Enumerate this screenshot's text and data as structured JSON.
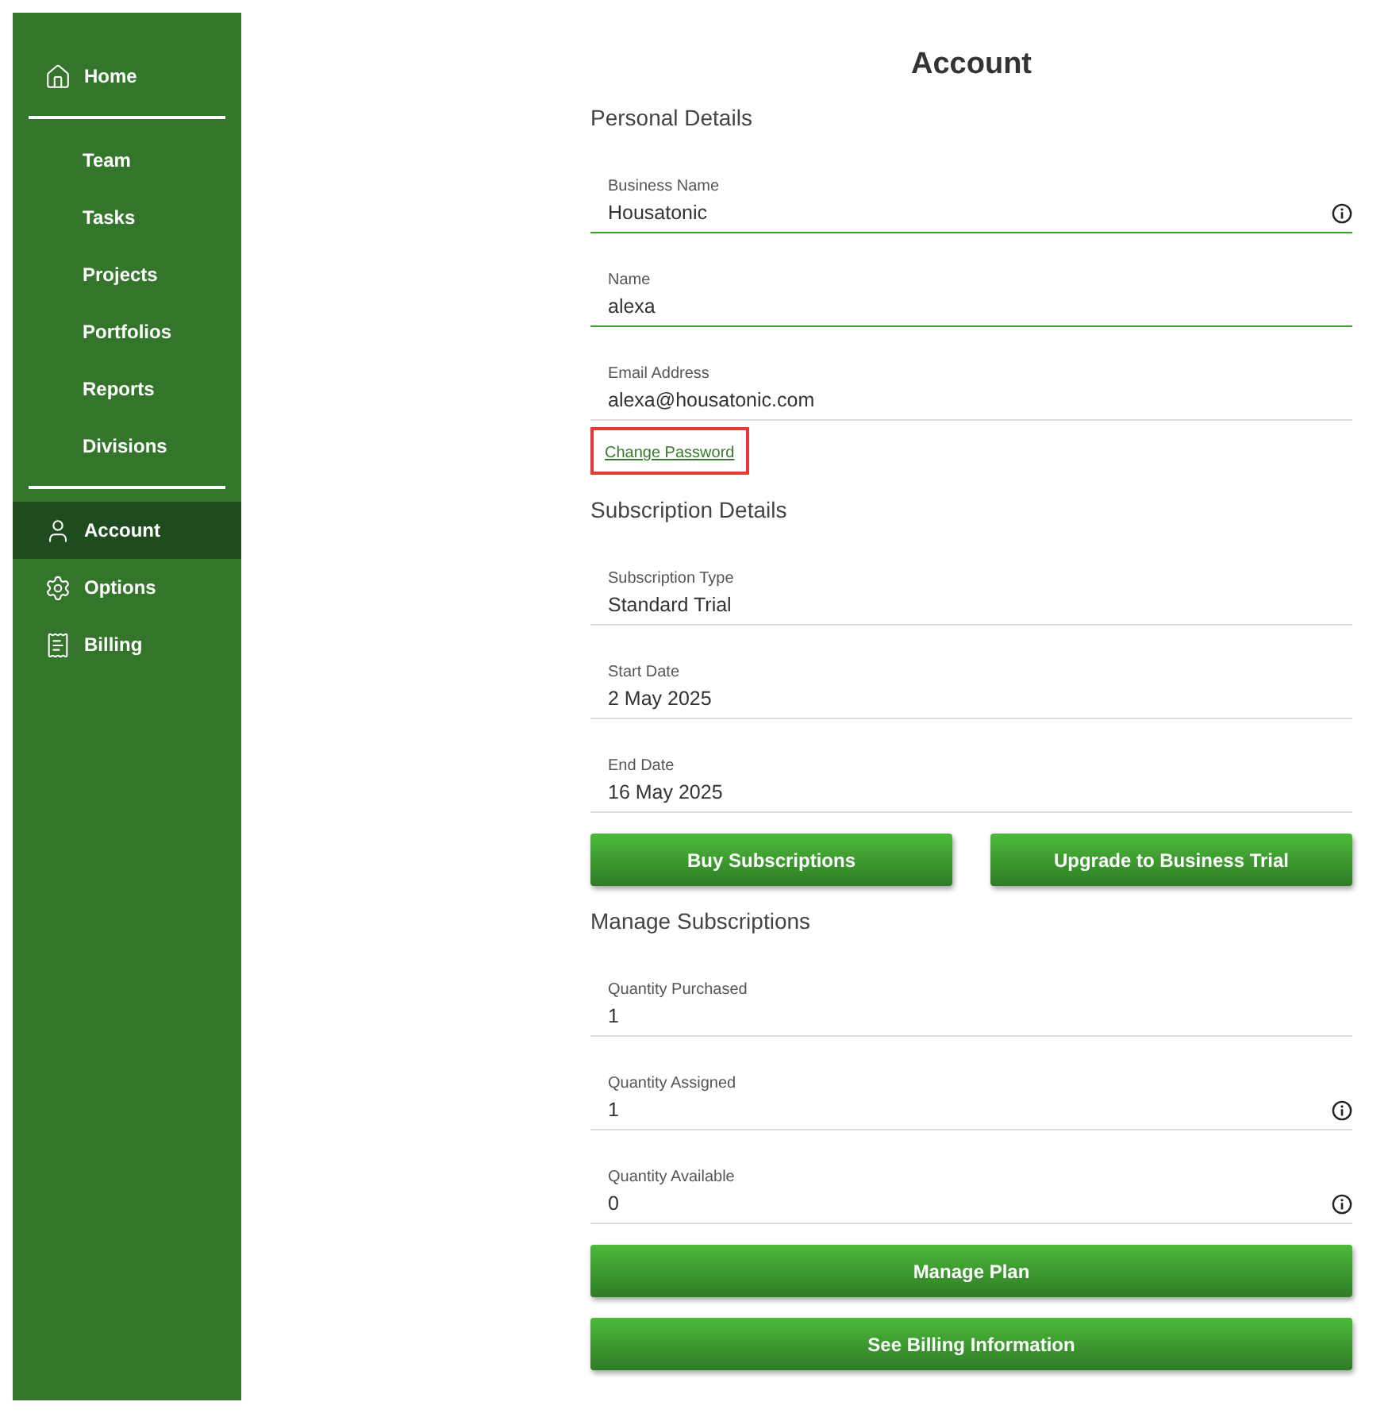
{
  "sidebar": {
    "items": [
      {
        "kind": "main",
        "label": "Home",
        "selected": false
      },
      {
        "kind": "divider"
      },
      {
        "kind": "sub",
        "label": "Team",
        "selected": false
      },
      {
        "kind": "sub",
        "label": "Tasks",
        "selected": false
      },
      {
        "kind": "sub",
        "label": "Projects",
        "selected": false
      },
      {
        "kind": "sub",
        "label": "Portfolios",
        "selected": false
      },
      {
        "kind": "sub",
        "label": "Reports",
        "selected": false
      },
      {
        "kind": "sub",
        "label": "Divisions",
        "selected": false
      },
      {
        "kind": "divider"
      },
      {
        "kind": "main",
        "label": "Account",
        "selected": true
      },
      {
        "kind": "main",
        "label": "Options",
        "selected": false
      },
      {
        "kind": "main",
        "label": "Billing",
        "selected": false
      }
    ]
  },
  "page_title": "Account",
  "sections": [
    {
      "kind": "fields",
      "heading": "Personal Details",
      "fields": [
        {
          "label": "Business Name",
          "value": "Housatonic",
          "editable": true,
          "info": true
        },
        {
          "label": "Name",
          "value": "alexa",
          "editable": true,
          "info": false
        },
        {
          "label": "Email Address",
          "value": "alexa@housatonic.com",
          "editable": false,
          "info": false
        }
      ]
    },
    {
      "kind": "link",
      "label": "Change Password",
      "highlighted": true
    },
    {
      "kind": "fields",
      "heading": "Subscription Details",
      "fields": [
        {
          "label": "Subscription Type",
          "value": "Standard Trial",
          "editable": false,
          "info": false
        },
        {
          "label": "Start Date",
          "value": "2 May 2025",
          "editable": false,
          "info": false
        },
        {
          "label": "End Date",
          "value": "16 May 2025",
          "editable": false,
          "info": false
        }
      ]
    },
    {
      "kind": "buttons",
      "buttons": [
        "Buy Subscriptions",
        "Upgrade to Business Trial"
      ]
    },
    {
      "kind": "fields",
      "heading": "Manage Subscriptions",
      "fields": [
        {
          "label": "Quantity Purchased",
          "value": "1",
          "editable": false,
          "info": false
        },
        {
          "label": "Quantity Assigned",
          "value": "1",
          "editable": false,
          "info": true
        },
        {
          "label": "Quantity Available",
          "value": "0",
          "editable": false,
          "info": true
        }
      ]
    },
    {
      "kind": "buttons",
      "buttons": [
        "Manage Plan"
      ]
    },
    {
      "kind": "buttons",
      "buttons": [
        "See Billing Information"
      ]
    }
  ]
}
